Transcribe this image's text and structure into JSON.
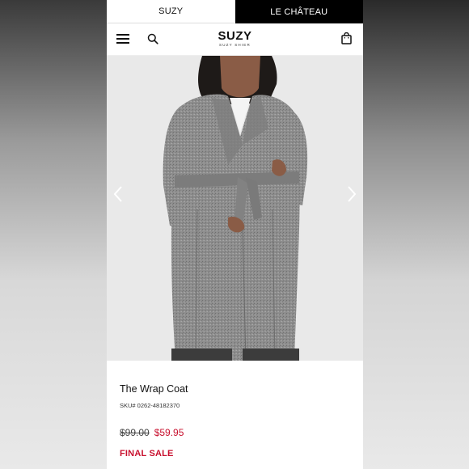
{
  "brand_tabs": [
    {
      "label": "SUZY",
      "active": true
    },
    {
      "label": "LE CHÂTEAU",
      "active": false
    }
  ],
  "header": {
    "logo_main": "SUZY",
    "logo_sub": "SUZY SHIER",
    "menu_icon": "hamburger-menu-icon",
    "search_icon": "search-icon",
    "bag_icon": "shopping-bag-icon"
  },
  "gallery": {
    "prev_icon": "chevron-left-icon",
    "next_icon": "chevron-right-icon"
  },
  "product": {
    "title": "The Wrap Coat",
    "sku": "SKU# 0262-48182370",
    "original_price": "$99.00",
    "sale_price": "$59.95",
    "sale_badge": "FINAL SALE"
  },
  "colors": {
    "sale_red": "#c8102e",
    "tab_black": "#000000",
    "hero_bg": "#e9e9e9"
  }
}
